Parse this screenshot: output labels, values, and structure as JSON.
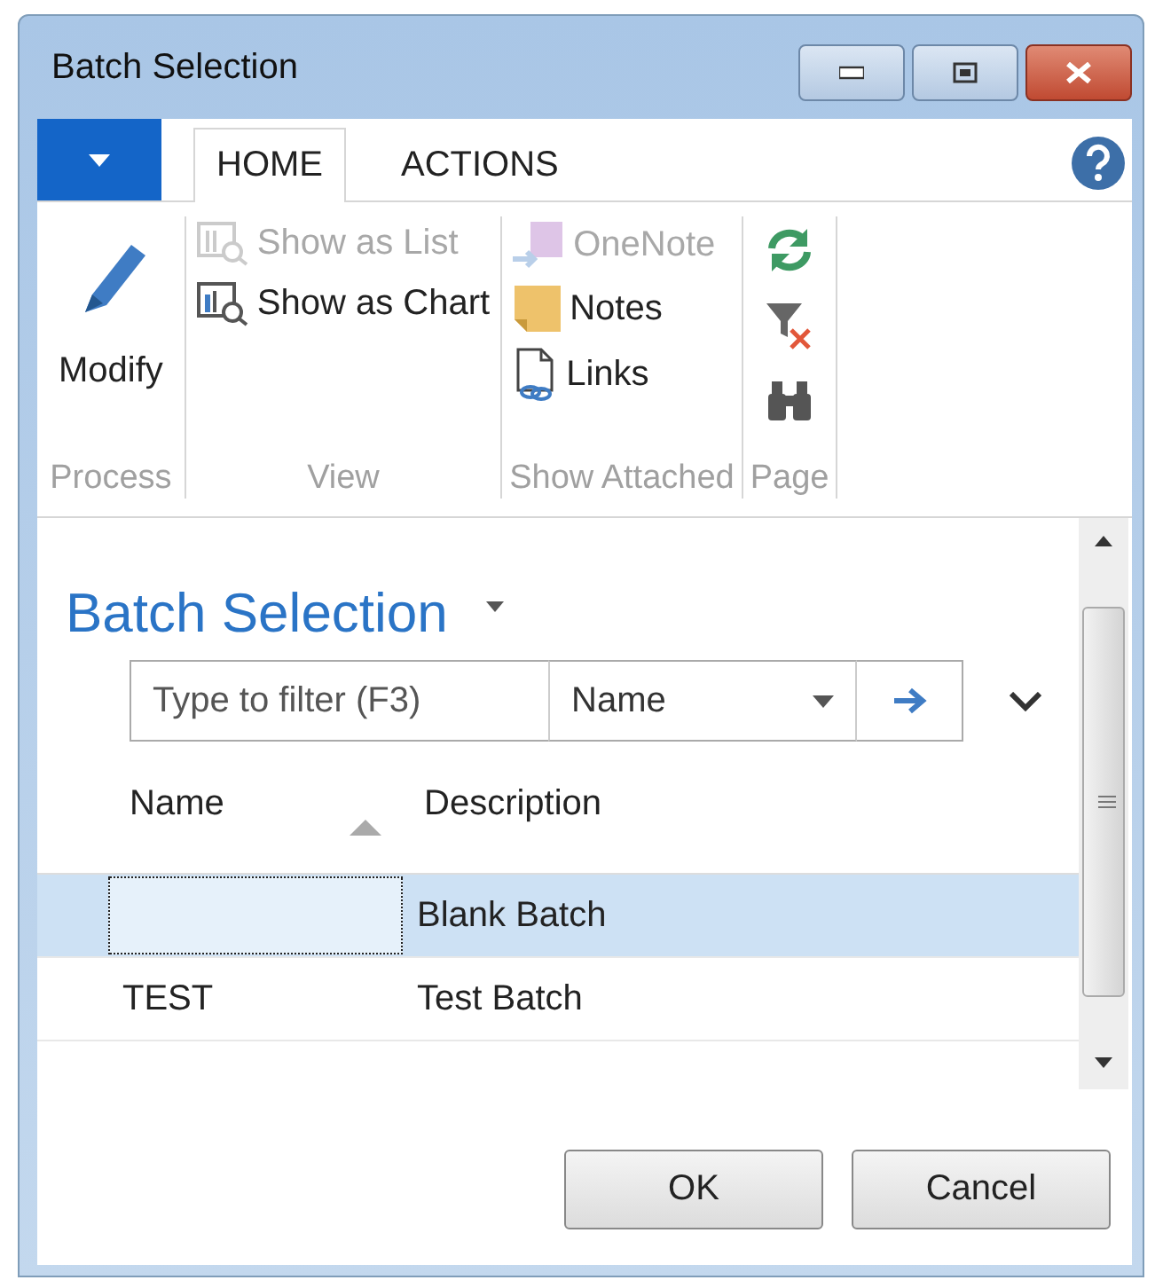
{
  "window": {
    "title": "Batch Selection"
  },
  "tabs": [
    {
      "label": "HOME",
      "selected": true
    },
    {
      "label": "ACTIONS",
      "selected": false
    }
  ],
  "ribbon": [
    {
      "label": "Process",
      "items": [
        {
          "label": "Modify",
          "disabled": false,
          "kind": "large"
        }
      ]
    },
    {
      "label": "View",
      "items": [
        {
          "label": "Show as List",
          "disabled": true,
          "kind": "small"
        },
        {
          "label": "Show as Chart",
          "disabled": false,
          "kind": "small"
        }
      ]
    },
    {
      "label": "Show Attached",
      "items": [
        {
          "label": "OneNote",
          "disabled": true,
          "kind": "small"
        },
        {
          "label": "Notes",
          "disabled": false,
          "kind": "small"
        },
        {
          "label": "Links",
          "disabled": false,
          "kind": "small"
        }
      ]
    },
    {
      "label": "Page",
      "items": [
        {
          "kind": "icon",
          "disabled": false
        },
        {
          "kind": "icon",
          "disabled": false
        },
        {
          "kind": "icon",
          "disabled": false
        }
      ]
    }
  ],
  "page_title": "Batch Selection",
  "filter": {
    "placeholder": "Type to filter (F3)",
    "field": "Name"
  },
  "table": {
    "columns": [
      "Name",
      "Description"
    ],
    "rows": [
      {
        "cells": [
          "",
          "Blank Batch"
        ],
        "selected": true
      },
      {
        "cells": [
          "TEST",
          "Test Batch"
        ],
        "selected": false
      }
    ]
  },
  "buttons": [
    "OK",
    "Cancel"
  ]
}
